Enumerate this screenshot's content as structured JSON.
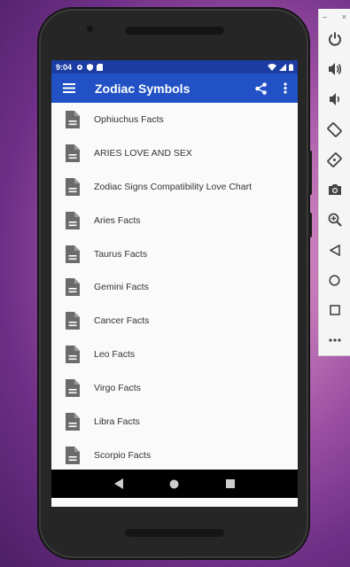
{
  "status_bar": {
    "time": "9:04"
  },
  "toolbar": {
    "title": "Zodiac Symbols"
  },
  "list": [
    {
      "label": "Ophiuchus Facts"
    },
    {
      "label": "ARIES LOVE AND SEX"
    },
    {
      "label": "Zodiac Signs Compatibility Love Chart"
    },
    {
      "label": "Aries Facts"
    },
    {
      "label": "Taurus Facts"
    },
    {
      "label": "Gemini Facts"
    },
    {
      "label": "Cancer Facts"
    },
    {
      "label": "Leo Facts"
    },
    {
      "label": "Virgo Facts"
    },
    {
      "label": "Libra Facts"
    },
    {
      "label": "Scorpio Facts"
    }
  ],
  "emulator_panel": {
    "minimize": "–",
    "close": "×",
    "icons": [
      "power-icon",
      "volume-up-icon",
      "volume-down-icon",
      "rotate-left-icon",
      "rotate-right-icon",
      "camera-icon",
      "zoom-icon",
      "back-icon",
      "home-icon",
      "overview-icon",
      "more-icon"
    ]
  },
  "colors": {
    "status_bar": "#1a3ca3",
    "toolbar": "#2151c4",
    "list_bg": "#fafafa",
    "doc_icon": "#6b6b6b"
  }
}
